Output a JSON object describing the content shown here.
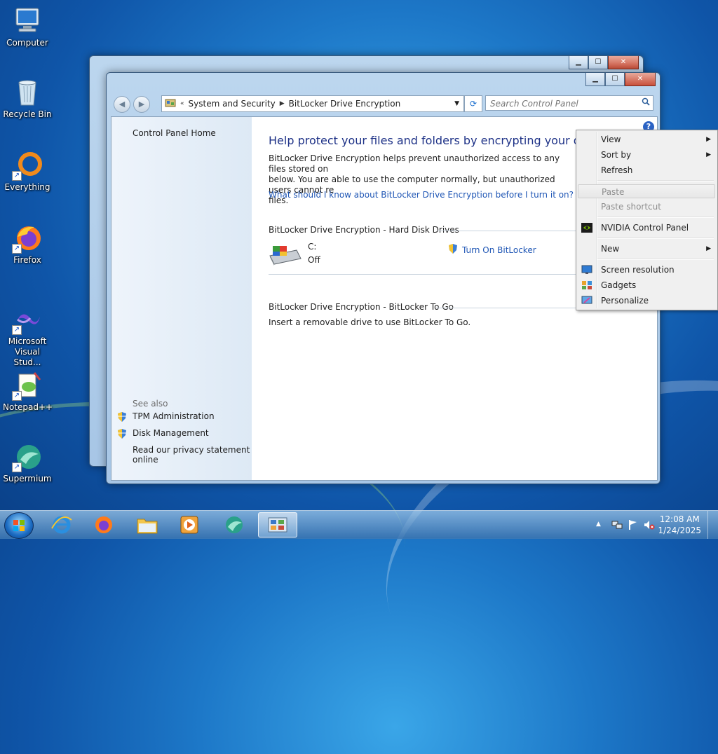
{
  "desktop": {
    "icons": [
      {
        "label": "Computer"
      },
      {
        "label": "Recycle Bin"
      },
      {
        "label": "Everything"
      },
      {
        "label": "Firefox"
      },
      {
        "label": "Microsoft Visual Stud..."
      },
      {
        "label": "Notepad++"
      },
      {
        "label": "Supermium"
      }
    ]
  },
  "window": {
    "caption_buttons": {
      "minimize": "▁",
      "maximize": "☐",
      "close": "✕"
    },
    "address": {
      "root_glyph": "«",
      "crumbs": [
        "System and Security",
        "BitLocker Drive Encryption"
      ],
      "dropdown": "▼",
      "refresh": "⟳"
    },
    "search": {
      "placeholder": "Search Control Panel",
      "icon": "search-icon"
    },
    "left_pane": {
      "home": "Control Panel Home",
      "see_also": "See also",
      "links": [
        "TPM Administration",
        "Disk Management"
      ],
      "privacy_line1": "Read our privacy statement",
      "privacy_line2": "online"
    },
    "main": {
      "title": "Help protect your files and folders by encrypting your drives",
      "desc_line1": "BitLocker Drive Encryption helps prevent unauthorized access to any files stored on",
      "desc_line2": "below. You are able to use the computer normally, but unauthorized users cannot re",
      "desc_line3": "files.",
      "learn_link": "What should I know about BitLocker Drive Encryption before I turn it on?",
      "section_hdd": "BitLocker Drive Encryption - Hard Disk Drives",
      "drive_name": "C:",
      "drive_status": "Off",
      "turn_on": "Turn On BitLocker",
      "section_togo": "BitLocker Drive Encryption - BitLocker To Go",
      "togo_text": "Insert a removable drive to use BitLocker To Go.",
      "help": "?"
    }
  },
  "context_menu": {
    "items": [
      {
        "label": "View",
        "submenu": true
      },
      {
        "label": "Sort by",
        "submenu": true
      },
      {
        "label": "Refresh"
      },
      {
        "label": "Paste",
        "disabled": true
      },
      {
        "label": "Paste shortcut",
        "disabled": true
      },
      {
        "label": "NVIDIA Control Panel",
        "icon": "nvidia-icon"
      },
      {
        "label": "New",
        "submenu": true
      },
      {
        "label": "Screen resolution",
        "icon": "monitor-icon"
      },
      {
        "label": "Gadgets",
        "icon": "gadgets-icon"
      },
      {
        "label": "Personalize",
        "icon": "personalize-icon"
      }
    ],
    "arrow": "▶"
  },
  "taskbar": {
    "tray_arrow": "▲",
    "time": "12:08 AM",
    "date": "1/24/2025"
  },
  "colors": {
    "link": "#1f56b5",
    "title": "#1e3287"
  }
}
